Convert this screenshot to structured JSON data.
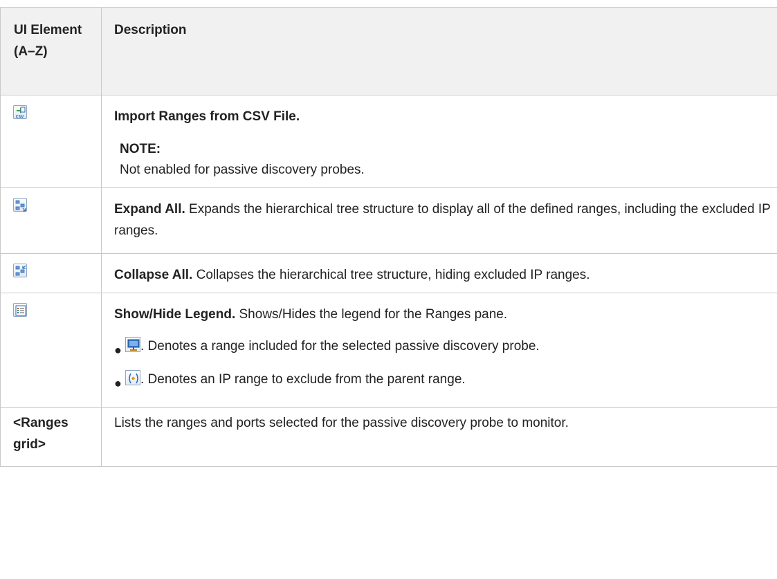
{
  "header": {
    "col_element": "UI Element (A–Z)",
    "col_description": "Description"
  },
  "rows": {
    "import_csv": {
      "icon": "import-csv-icon",
      "title": "Import Ranges from CSV File.",
      "note_title": "NOTE:",
      "note_text": "Not enabled for passive discovery probes."
    },
    "expand_all": {
      "icon": "expand-all-icon",
      "title": "Expand All.",
      "text": " Expands the hierarchical tree structure to display all of the defined ranges, including the excluded IP ranges."
    },
    "collapse_all": {
      "icon": "collapse-all-icon",
      "title": "Collapse All.",
      "text": " Collapses the hierarchical tree structure, hiding excluded IP ranges."
    },
    "show_hide_legend": {
      "icon": "legend-icon",
      "title": "Show/Hide Legend.",
      "text": " Shows/Hides the legend for the Ranges pane.",
      "legend": [
        {
          "icon": "included-range-icon",
          "text": ". Denotes a range included for the selected passive discovery probe."
        },
        {
          "icon": "excluded-range-icon",
          "text": ". Denotes an IP range to exclude from the parent range."
        }
      ]
    },
    "ranges_grid": {
      "element": "<Ranges grid>",
      "text": "Lists the ranges and ports selected for the passive discovery probe to monitor."
    }
  },
  "colors": {
    "border": "#c8c8c8",
    "header_bg": "#f1f1f1",
    "text": "#222222",
    "icon_blue": "#2e6bb8",
    "icon_green": "#3a9a3a"
  }
}
